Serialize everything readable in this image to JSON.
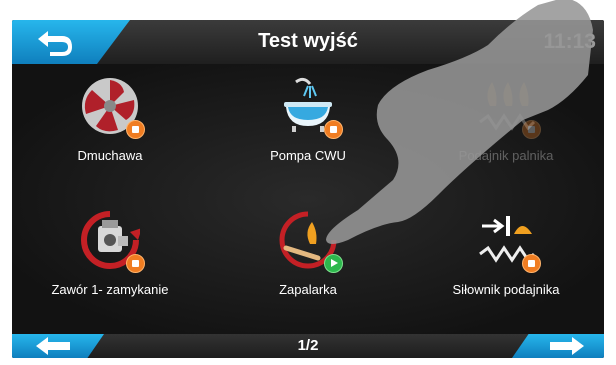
{
  "header": {
    "title": "Test wyjść",
    "clock": "11:13",
    "back_icon": "back-arrow-icon"
  },
  "tiles": [
    {
      "label": "Dmuchawa",
      "icon": "fan-icon",
      "status": "stop"
    },
    {
      "label": "Pompa CWU",
      "icon": "bathtub-pump-icon",
      "status": "stop"
    },
    {
      "label": "Podajnik palnika",
      "icon": "burner-feeder-icon",
      "status": "stop"
    },
    {
      "label": "Zawór 1- zamykanie",
      "icon": "valve-icon",
      "status": "stop"
    },
    {
      "label": "Zapalarka",
      "icon": "igniter-icon",
      "status": "play"
    },
    {
      "label": "Siłownik podajnika",
      "icon": "feeder-actuator-icon",
      "status": "stop"
    }
  ],
  "footer": {
    "page": "1/2",
    "prev_icon": "arrow-left-icon",
    "next_icon": "arrow-right-icon"
  },
  "colors": {
    "accent": "#1a9fd9",
    "status_stop": "#f07d22",
    "status_play": "#2db84d"
  }
}
